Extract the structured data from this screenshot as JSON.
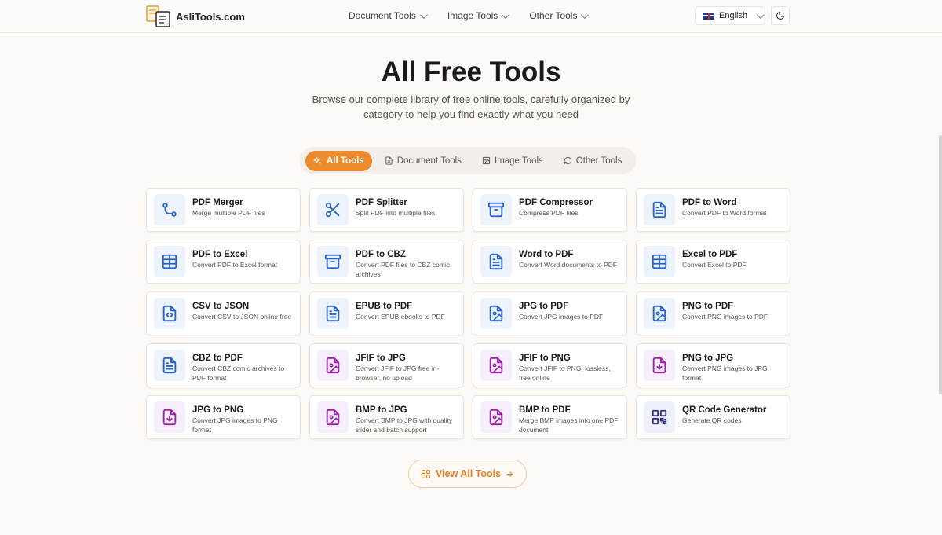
{
  "brand": {
    "name": "AsliTools.com"
  },
  "nav": [
    {
      "label": "Document Tools"
    },
    {
      "label": "Image Tools"
    },
    {
      "label": "Other Tools"
    }
  ],
  "language": {
    "selected": "English",
    "flag": "uk-flag-icon"
  },
  "theme_toggle": {
    "icon": "moon-icon"
  },
  "hero": {
    "title": "All Free Tools",
    "subtitle": "Browse our complete library of free online tools, carefully organized by category to help you find exactly what you need"
  },
  "tabs": [
    {
      "label": "All Tools",
      "icon": "sparkles-icon",
      "active": true
    },
    {
      "label": "Document Tools",
      "icon": "file-icon",
      "active": false
    },
    {
      "label": "Image Tools",
      "icon": "image-icon",
      "active": false
    },
    {
      "label": "Other Tools",
      "icon": "refresh-icon",
      "active": false
    }
  ],
  "tools": [
    {
      "name": "PDF Merger",
      "desc": "Merge multiple PDF files",
      "icon": "merge-icon",
      "color": "blue"
    },
    {
      "name": "PDF Splitter",
      "desc": "Split PDF into multiple files",
      "icon": "scissors-icon",
      "color": "blue"
    },
    {
      "name": "PDF Compressor",
      "desc": "Compress PDF files",
      "icon": "archive-icon",
      "color": "blue"
    },
    {
      "name": "PDF to Word",
      "desc": "Convert PDF to Word format",
      "icon": "document-icon",
      "color": "blue"
    },
    {
      "name": "PDF to Excel",
      "desc": "Convert PDF to Excel format",
      "icon": "table-icon",
      "color": "blue"
    },
    {
      "name": "PDF to CBZ",
      "desc": "Convert PDF files to CBZ comic archives",
      "icon": "archive-icon",
      "color": "blue"
    },
    {
      "name": "Word to PDF",
      "desc": "Convert Word documents to PDF",
      "icon": "document-icon",
      "color": "blue"
    },
    {
      "name": "Excel to PDF",
      "desc": "Convert Excel to PDF",
      "icon": "table-icon",
      "color": "blue"
    },
    {
      "name": "CSV to JSON",
      "desc": "Convert CSV to JSON online free",
      "icon": "code-file-icon",
      "color": "blue"
    },
    {
      "name": "EPUB to PDF",
      "desc": "Convert EPUB ebooks to PDF",
      "icon": "document-icon",
      "color": "blue"
    },
    {
      "name": "JPG to PDF",
      "desc": "Convert JPG images to PDF",
      "icon": "image-file-icon",
      "color": "blue"
    },
    {
      "name": "PNG to PDF",
      "desc": "Convert PNG images to PDF",
      "icon": "image-file-icon",
      "color": "blue"
    },
    {
      "name": "CBZ to PDF",
      "desc": "Convert CBZ comic archives to PDF format",
      "icon": "document-icon",
      "color": "blue"
    },
    {
      "name": "JFIF to JPG",
      "desc": "Convert JFIF to JPG free in-browser, no upload",
      "icon": "image-file-icon",
      "color": "purple"
    },
    {
      "name": "JFIF to PNG",
      "desc": "Convert JFIF to PNG, lossless, free online",
      "icon": "image-file-icon",
      "color": "purple"
    },
    {
      "name": "PNG to JPG",
      "desc": "Convert PNG images to JPG format",
      "icon": "download-file-icon",
      "color": "purple"
    },
    {
      "name": "JPG to PNG",
      "desc": "Convert JPG images to PNG format",
      "icon": "download-file-icon",
      "color": "purple"
    },
    {
      "name": "BMP to JPG",
      "desc": "Convert BMP to JPG with quality slider and batch support",
      "icon": "image-file-icon",
      "color": "purple"
    },
    {
      "name": "BMP to PDF",
      "desc": "Merge BMP images into one PDF document",
      "icon": "image-file-icon",
      "color": "purple"
    },
    {
      "name": "QR Code Generator",
      "desc": "Generate QR codes",
      "icon": "qr-code-icon",
      "color": "indigo"
    }
  ],
  "view_all": {
    "label": "View All Tools",
    "icon": "grid-icon"
  },
  "colors": {
    "accent": "#ed8a2c",
    "blue_icon": "#2563c9",
    "purple_icon": "#a21caf",
    "indigo_icon": "#312e81"
  }
}
